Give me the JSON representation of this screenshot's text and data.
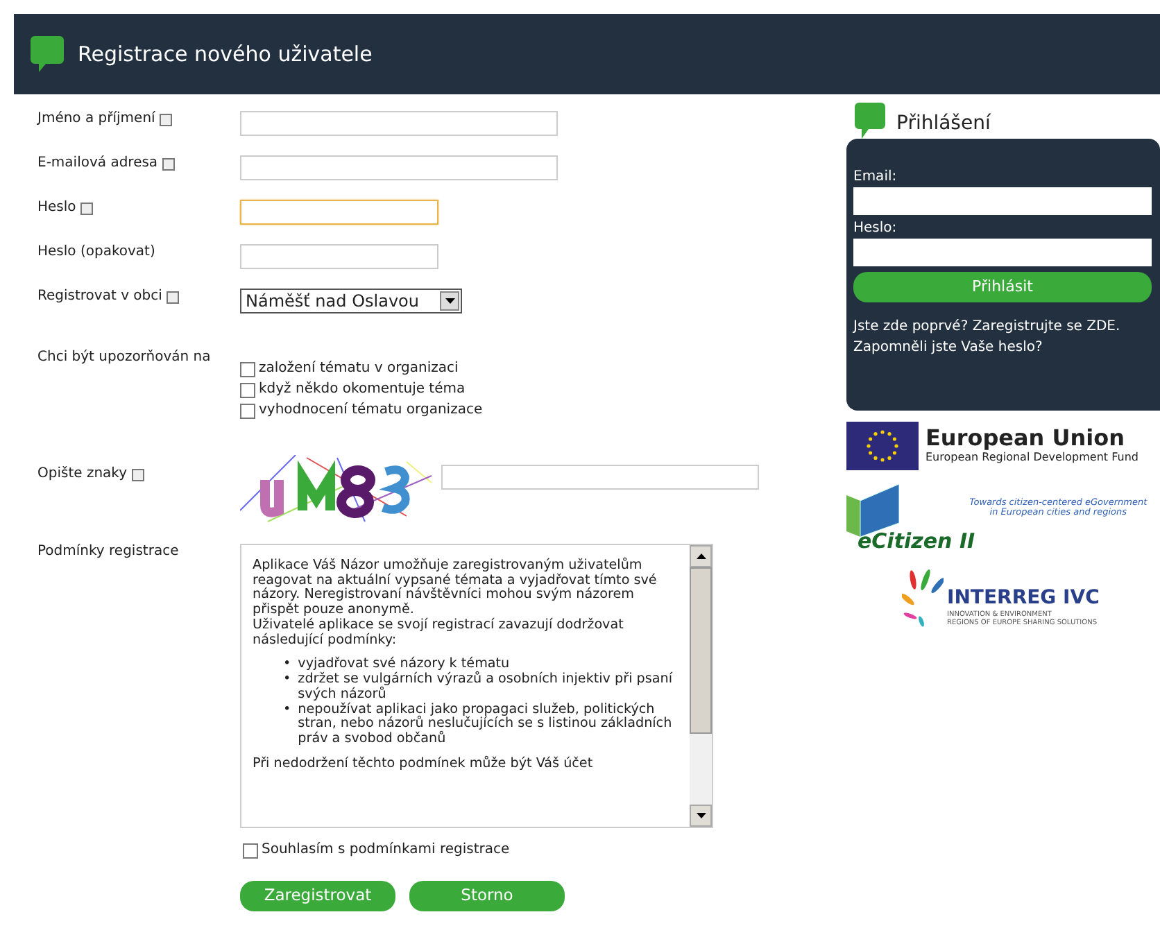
{
  "header": {
    "title": "Registrace nového uživatele"
  },
  "form": [
    {
      "kind": "text",
      "label": "Jméno a příjmení",
      "info": true,
      "focused": false
    },
    {
      "kind": "text",
      "label": "E-mailová adresa",
      "info": true,
      "focused": false
    },
    {
      "kind": "password",
      "label": "Heslo",
      "info": true,
      "focused": true
    },
    {
      "kind": "password",
      "label": "Heslo (opakovat)",
      "info": false,
      "focused": false
    },
    {
      "kind": "select",
      "label": "Registrovat v obci",
      "info": true,
      "value": "Náměšť nad Oslavou"
    },
    {
      "kind": "checks",
      "label": "Chci být upozorňován na",
      "options": [
        {
          "label": "založení tématu v organizaci",
          "checked": false
        },
        {
          "label": "když někdo okomentuje téma",
          "checked": false
        },
        {
          "label": "vyhodnocení tématu organizace",
          "checked": false
        }
      ]
    },
    {
      "kind": "captcha",
      "label": "Opište znaky",
      "info": true
    }
  ],
  "terms": {
    "label": "Podmínky registrace",
    "marker": "•",
    "paragraphs": [
      "Aplikace Váš Názor umožňuje zaregistrovaným uživatelům reagovat na aktuální vypsané témata a vyjadřovat tímto své názory. Neregistrovaní návštěvníci mohou svým názorem přispět pouze anonymě.",
      "Uživatelé aplikace se svojí registrací zavazují dodržovat následující podmínky:"
    ],
    "bullets": [
      "vyjadřovat své názory k tématu",
      "zdržet se vulgárních výrazů a osobních injektiv při psaní svých názorů",
      "nepoužívat aplikaci jako propagaci služeb, politických stran, nebo názorů neslučujících se s listinou základních práv a svobod občanů"
    ],
    "after": "Při nedodržení těchto podmínek může být Váš účet"
  },
  "agree": {
    "label": "Souhlasím s podmínkami registrace",
    "checked": false
  },
  "buttons": [
    "Zaregistrovat",
    "Storno"
  ],
  "login": {
    "title": "Přihlášení",
    "email_label": "Email:",
    "password_label": "Heslo:",
    "button": "Přihlásit",
    "links": [
      "Jste zde poprvé? Zaregistrujte se ZDE.",
      "Zapomněli jste Vaše heslo?"
    ]
  },
  "logos": {
    "eu_title": "European Union",
    "eu_subtitle": "European Regional Development Fund",
    "ecitizen_tagline": [
      "Towards citizen-centered eGovernment",
      "in European cities and regions"
    ],
    "ecitizen_name": "eCitizen II",
    "interreg_name": "INTERREG IVC",
    "interreg_lines": [
      "INNOVATION & ENVIRONMENT",
      "REGIONS OF EUROPE SHARING SOLUTIONS"
    ]
  }
}
